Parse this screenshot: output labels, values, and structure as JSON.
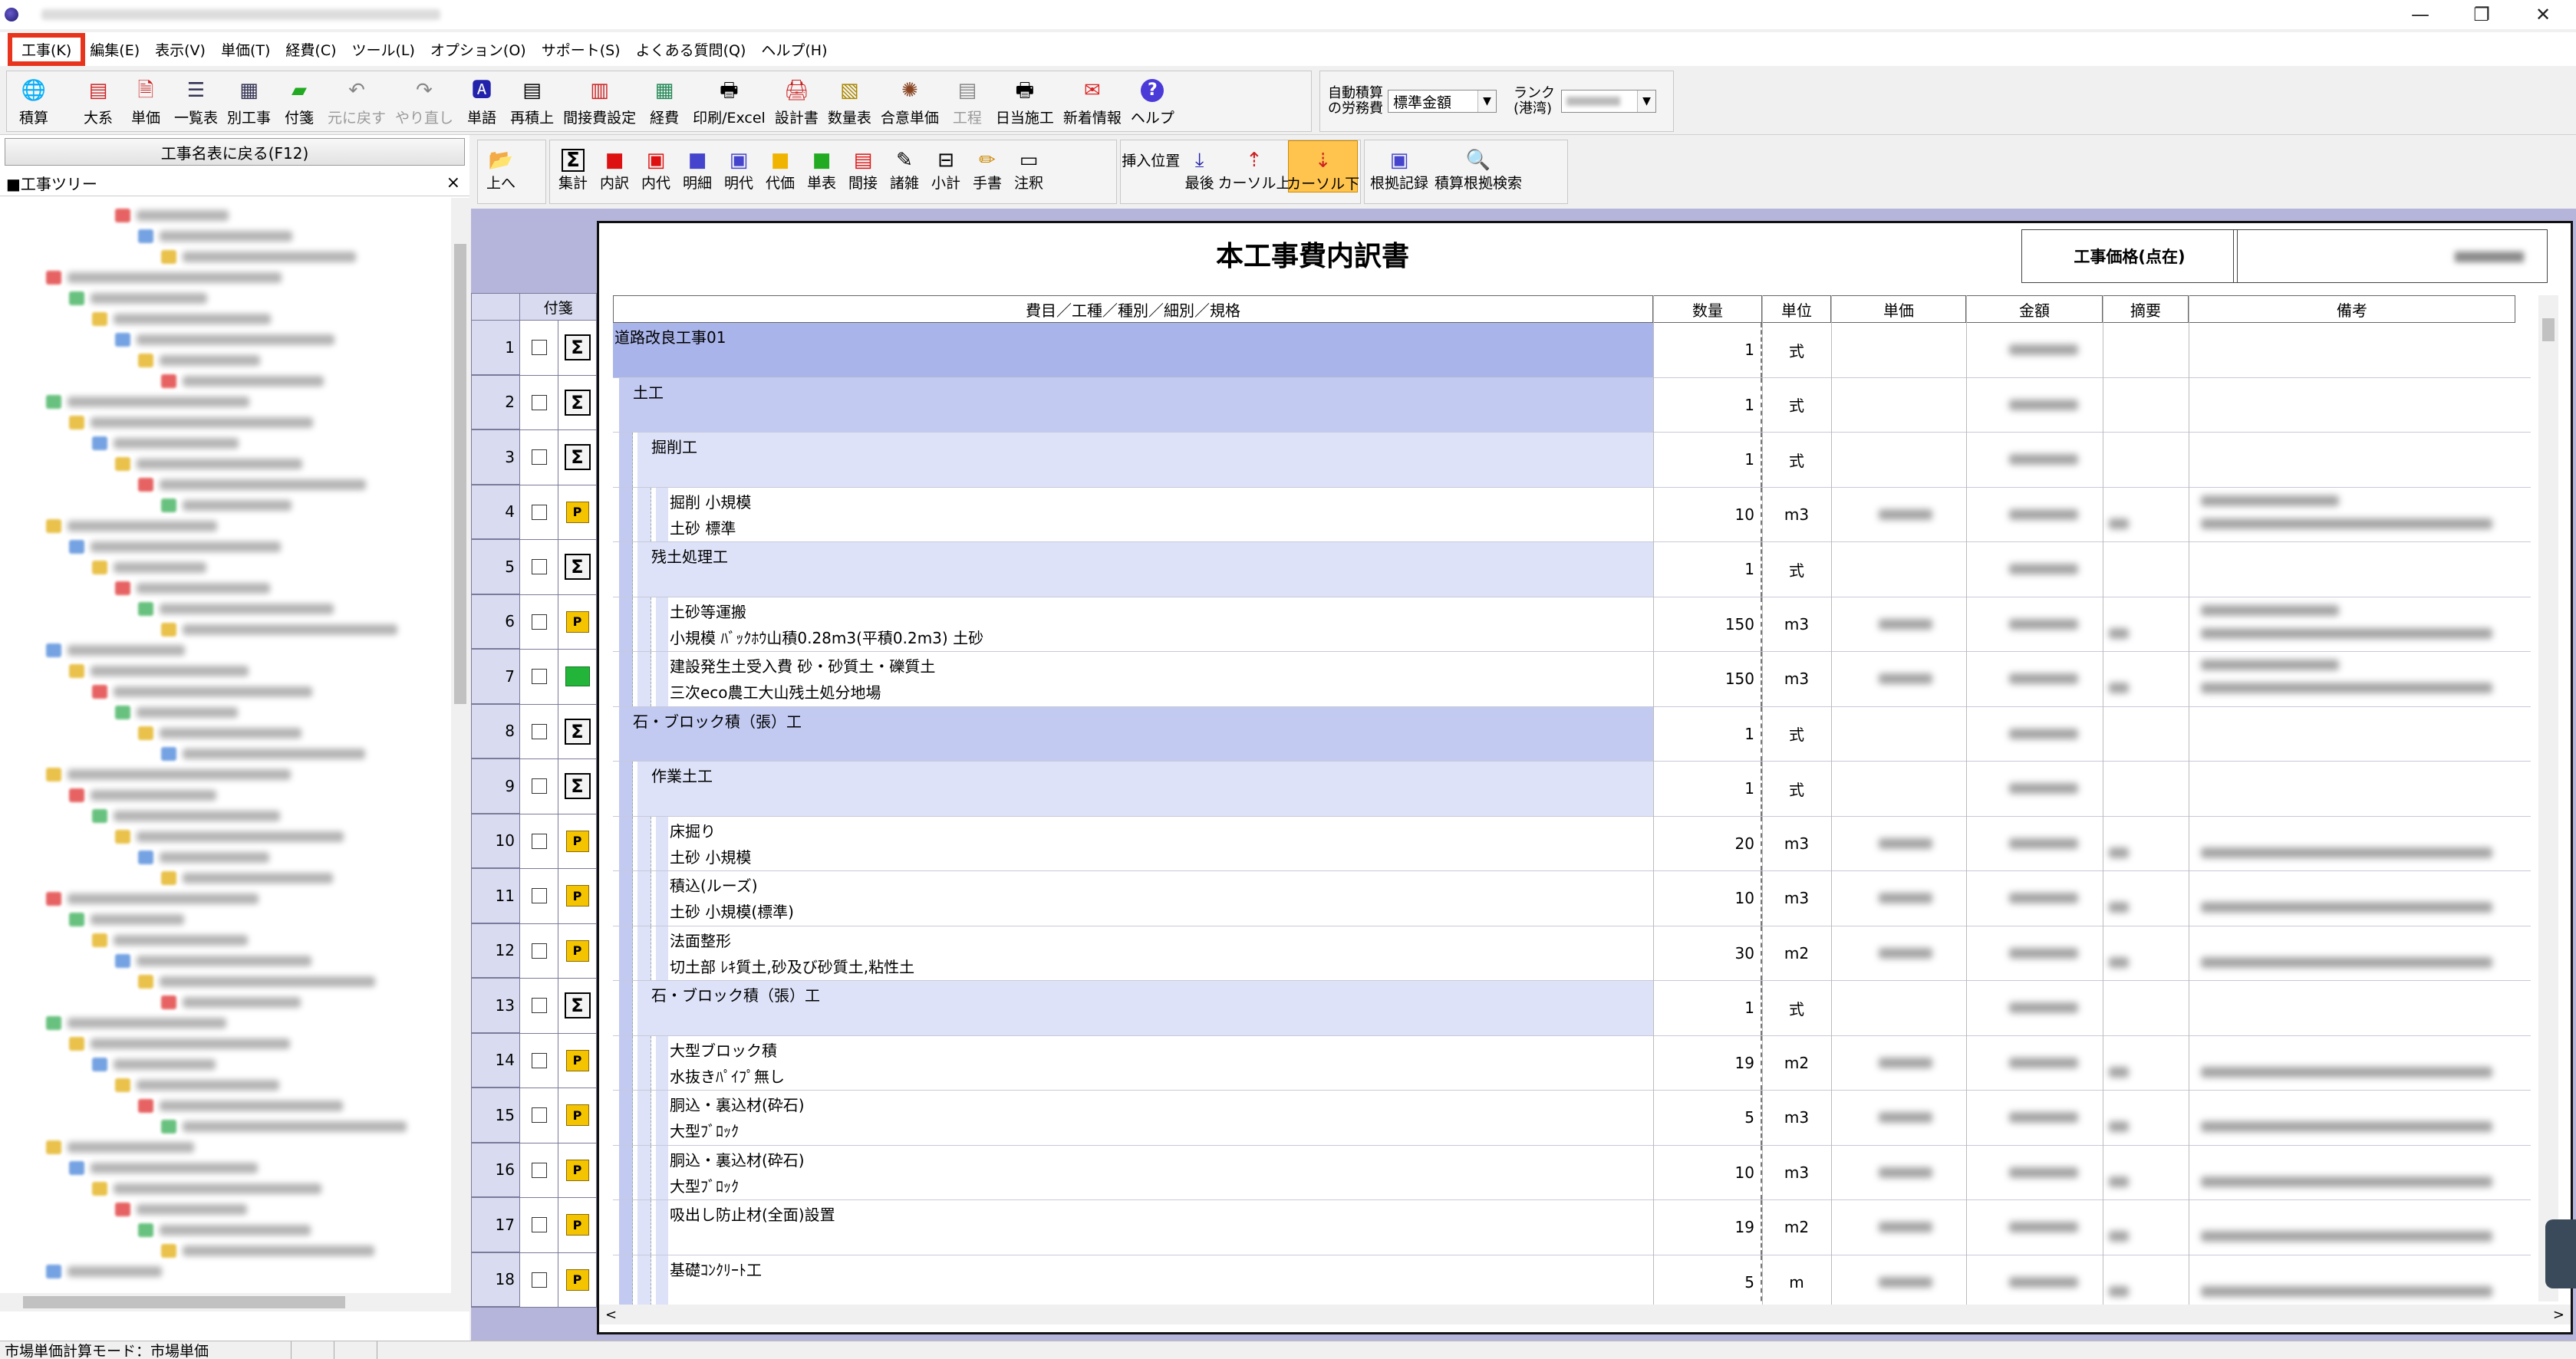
{
  "menu": [
    "工事(K)",
    "編集(E)",
    "表示(V)",
    "単価(T)",
    "経費(C)",
    "ツール(L)",
    "オプション(O)",
    "サポート(S)",
    "よくある質問(Q)",
    "ヘルプ(H)"
  ],
  "toolbar1": {
    "buttons": [
      {
        "label": "積算",
        "icon": "estimate-icon"
      },
      {
        "label": "大系",
        "icon": "system-icon"
      },
      {
        "label": "単価",
        "icon": "unit-price-icon"
      },
      {
        "label": "一覧表",
        "icon": "list-icon"
      },
      {
        "label": "別工事",
        "icon": "other-work-icon"
      },
      {
        "label": "付箋",
        "icon": "sticky-note-icon"
      },
      {
        "label": "元に戻す",
        "icon": "undo-icon"
      },
      {
        "label": "やり直し",
        "icon": "redo-icon"
      },
      {
        "label": "単語",
        "icon": "word-icon"
      },
      {
        "label": "再積上",
        "icon": "recalc-icon"
      },
      {
        "label": "間接費設定",
        "icon": "indirect-cost-icon"
      },
      {
        "label": "経費",
        "icon": "expense-icon"
      },
      {
        "label": "印刷/Excel",
        "icon": "print-icon"
      },
      {
        "label": "設計書",
        "icon": "design-doc-icon"
      },
      {
        "label": "数量表",
        "icon": "quantity-table-icon"
      },
      {
        "label": "合意単価",
        "icon": "agreed-price-icon"
      },
      {
        "label": "工程",
        "icon": "schedule-icon"
      },
      {
        "label": "日当施工",
        "icon": "daily-work-icon"
      },
      {
        "label": "新着情報",
        "icon": "news-icon"
      },
      {
        "label": "ヘルプ",
        "icon": "help-icon"
      }
    ],
    "auto_labor_label_1": "自動積算",
    "auto_labor_label_2": "の労務費",
    "auto_labor_value": "標準金額",
    "rank_label_1": "ランク",
    "rank_label_2": "(港湾)"
  },
  "left_panel": {
    "back_button": "工事名表に戻る(F12)",
    "tree_title": "■工事ツリー",
    "close": "×"
  },
  "toolbar2": {
    "buttons": [
      {
        "label": "上へ",
        "icon": "up-folder-icon"
      },
      {
        "label": "集計",
        "icon": "sum-icon"
      },
      {
        "label": "内訳",
        "icon": "breakdown-icon"
      },
      {
        "label": "内代",
        "icon": "internal-substitute-icon"
      },
      {
        "label": "明細",
        "icon": "detail-icon"
      },
      {
        "label": "明代",
        "icon": "detail-substitute-icon"
      },
      {
        "label": "代価",
        "icon": "cost-icon"
      },
      {
        "label": "単表",
        "icon": "unit-table-icon"
      },
      {
        "label": "間接",
        "icon": "indirect-icon"
      },
      {
        "label": "諸雑",
        "icon": "misc-icon"
      },
      {
        "label": "小計",
        "icon": "subtotal-icon"
      },
      {
        "label": "手書",
        "icon": "handwrite-icon"
      },
      {
        "label": "注釈",
        "icon": "memo-icon"
      },
      {
        "label": "挿入位置",
        "icon": "insert-position-icon"
      },
      {
        "label": "最後",
        "icon": "last-icon"
      },
      {
        "label": "カーソル上",
        "icon": "cursor-up-icon"
      },
      {
        "label": "カーソル下",
        "icon": "cursor-down-icon"
      },
      {
        "label": "根拠記録",
        "icon": "basis-record-icon"
      },
      {
        "label": "積算根拠検索",
        "icon": "basis-search-icon"
      }
    ]
  },
  "sheet": {
    "title": "本工事費内訳書",
    "price_label": "工事価格(点在)",
    "row_header_label": "付箋",
    "columns": [
      "費目／工種／種別／細別／規格",
      "数量",
      "単位",
      "単価",
      "金額",
      "摘要",
      "備考"
    ],
    "rows": [
      {
        "num": "1",
        "icon": "sigma",
        "level": 0,
        "line1": "道路改良工事01",
        "line2": "",
        "qty": "1",
        "unit": "式",
        "shade": "dark"
      },
      {
        "num": "2",
        "icon": "sigma",
        "level": 1,
        "line1": "土工",
        "line2": "",
        "qty": "1",
        "unit": "式",
        "shade": "mid"
      },
      {
        "num": "3",
        "icon": "sigma",
        "level": 2,
        "line1": "掘削工",
        "line2": "",
        "qty": "1",
        "unit": "式",
        "shade": "light"
      },
      {
        "num": "4",
        "icon": "p",
        "level": 3,
        "line1": "掘削 小規模",
        "line2": "土砂 標準",
        "qty": "10",
        "unit": "m3",
        "shade": "none"
      },
      {
        "num": "5",
        "icon": "sigma",
        "level": 2,
        "line1": "残土処理工",
        "line2": "",
        "qty": "1",
        "unit": "式",
        "shade": "light"
      },
      {
        "num": "6",
        "icon": "p",
        "level": 3,
        "line1": "土砂等運搬",
        "line2": "小規模 ﾊﾞｯｸﾎｳ山積0.28m3(平積0.2m3) 土砂",
        "qty": "150",
        "unit": "m3",
        "shade": "none"
      },
      {
        "num": "7",
        "icon": "g",
        "level": 3,
        "line1": "建設発生土受入費 砂・砂質土・礫質土",
        "line2": "三次eco農工大山残土処分地場",
        "qty": "150",
        "unit": "m3",
        "shade": "none"
      },
      {
        "num": "8",
        "icon": "sigma",
        "level": 1,
        "line1": "石・ブロック積（張）工",
        "line2": "",
        "qty": "1",
        "unit": "式",
        "shade": "mid"
      },
      {
        "num": "9",
        "icon": "sigma",
        "level": 2,
        "line1": "作業土工",
        "line2": "",
        "qty": "1",
        "unit": "式",
        "shade": "light"
      },
      {
        "num": "10",
        "icon": "p",
        "level": 3,
        "line1": "床掘り",
        "line2": "土砂 小規模",
        "qty": "20",
        "unit": "m3",
        "shade": "none"
      },
      {
        "num": "11",
        "icon": "p",
        "level": 3,
        "line1": "積込(ルーズ)",
        "line2": "土砂 小規模(標準)",
        "qty": "10",
        "unit": "m3",
        "shade": "none"
      },
      {
        "num": "12",
        "icon": "p",
        "level": 3,
        "line1": "法面整形",
        "line2": "切土部 ﾚｷ質土,砂及び砂質土,粘性土",
        "qty": "30",
        "unit": "m2",
        "shade": "none"
      },
      {
        "num": "13",
        "icon": "sigma",
        "level": 2,
        "line1": "石・ブロック積（張）工",
        "line2": "",
        "qty": "1",
        "unit": "式",
        "shade": "light"
      },
      {
        "num": "14",
        "icon": "p",
        "level": 3,
        "line1": "大型ブロック積",
        "line2": "水抜きﾊﾟｲﾌﾟ無し",
        "qty": "19",
        "unit": "m2",
        "shade": "none"
      },
      {
        "num": "15",
        "icon": "p",
        "level": 3,
        "line1": "胴込・裏込材(砕石)",
        "line2": "大型ﾌﾞﾛｯｸ",
        "qty": "5",
        "unit": "m3",
        "shade": "none"
      },
      {
        "num": "16",
        "icon": "p",
        "level": 3,
        "line1": "胴込・裏込材(砕石)",
        "line2": "大型ﾌﾞﾛｯｸ",
        "qty": "10",
        "unit": "m3",
        "shade": "none"
      },
      {
        "num": "17",
        "icon": "p",
        "level": 3,
        "line1": "吸出し防止材(全面)設置",
        "line2": "",
        "qty": "19",
        "unit": "m2",
        "shade": "none"
      },
      {
        "num": "18",
        "icon": "p",
        "level": 3,
        "line1": "基礎ｺﾝｸﾘｰﾄ工",
        "line2": "",
        "qty": "5",
        "unit": "m",
        "shade": "none"
      }
    ]
  },
  "status": {
    "mode": "市場単価計算モード：市場単価"
  },
  "colors": {
    "highlight": "#e8341c",
    "shade_dark": "#a9b4ea",
    "shade_mid": "#c2caf2",
    "shade_light": "#dde2f8",
    "main_bg": "#b5b5dc"
  }
}
